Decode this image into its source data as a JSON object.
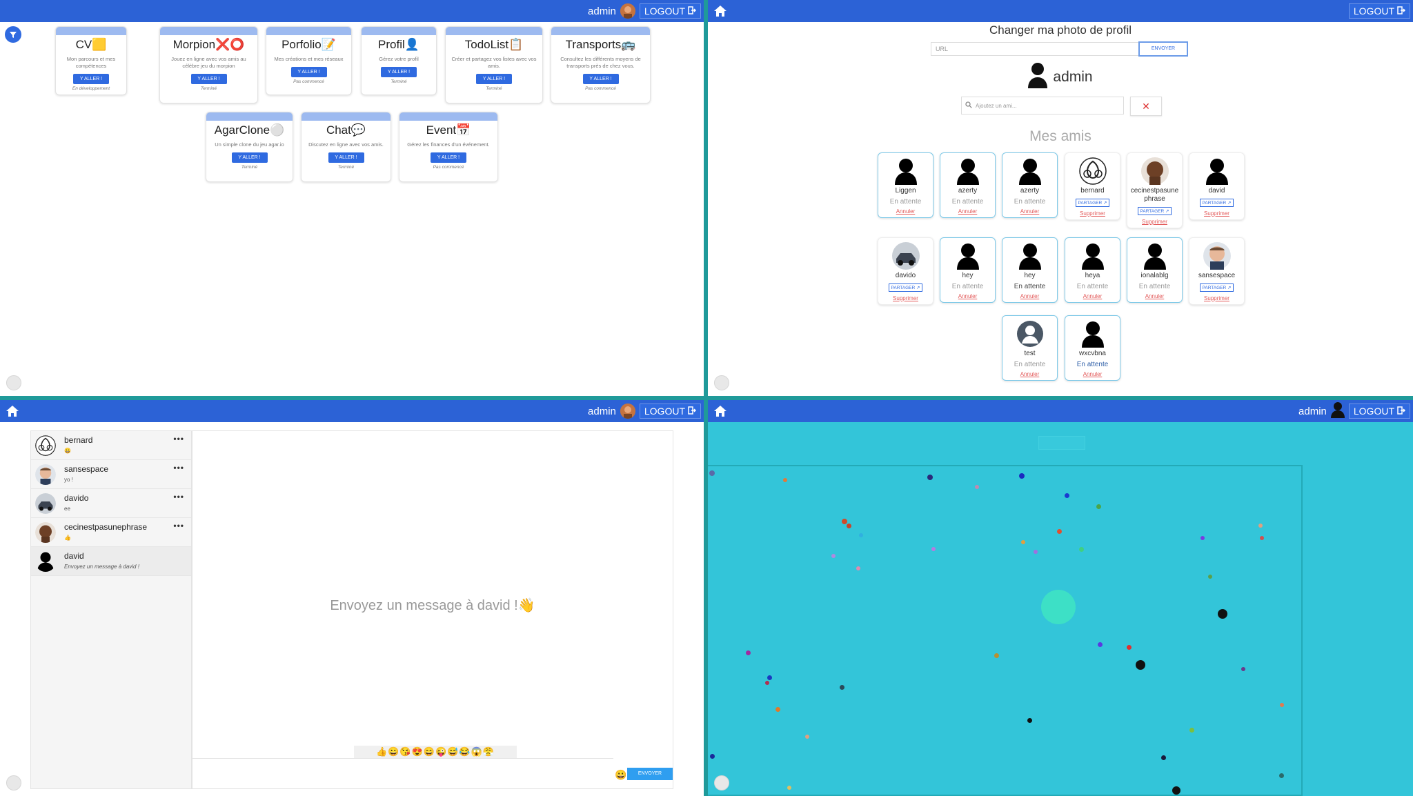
{
  "nav": {
    "user": "admin",
    "logout_label": "LOGOUT"
  },
  "projects": [
    {
      "title": "CV",
      "emoji": "🟨",
      "desc": "Mon parcours et mes compétences",
      "button": "Y ALLER !",
      "status": "En développement"
    },
    {
      "title": "Morpion",
      "emoji": "❌⭕",
      "desc": "Jouez en ligne avec vos amis au célèbre jeu du morpion",
      "button": "Y ALLER !",
      "status": "Terminé"
    },
    {
      "title": "Porfolio",
      "emoji": "📝",
      "desc": "Mes créations et mes réseaux",
      "button": "Y ALLER !",
      "status": "Pas commencé"
    },
    {
      "title": "Profil",
      "emoji": "👤",
      "desc": "Gérez votre profil",
      "button": "Y ALLER !",
      "status": "Terminé"
    },
    {
      "title": "TodoList",
      "emoji": "📋",
      "desc": "Créer et partagez vos listes avec vos amis.",
      "button": "Y ALLER !",
      "status": "Terminé"
    },
    {
      "title": "Transports",
      "emoji": "🚌",
      "desc": "Consultez les différents moyens de transports près de chez vous.",
      "button": "Y ALLER !",
      "status": "Pas commencé"
    },
    {
      "title": "AgarClone",
      "emoji": "⚪",
      "desc": "Un simple clone du jeu agar.io",
      "button": "Y ALLER !",
      "status": "Terminé"
    },
    {
      "title": "Chat",
      "emoji": "💬",
      "desc": "Discutez en ligne avec vos amis.",
      "button": "Y ALLER !",
      "status": "Terminé"
    },
    {
      "title": "Event",
      "emoji": "📅",
      "desc": "Gérez les finances d'un événement.",
      "button": "Y ALLER !",
      "status": "Pas commencé"
    }
  ],
  "profile": {
    "photo_title": "Changer ma photo de profil",
    "url_placeholder": "URL",
    "send_label": "ENVOYER",
    "username": "admin",
    "add_friend_placeholder": "Ajoutez un ami...",
    "clear_label": "✕",
    "friends_title": "Mes amis",
    "friends": [
      {
        "name": "Liggen",
        "status": "En attente",
        "action": "Annuler",
        "kind": "pending",
        "status_style": "grey",
        "avatar": "person"
      },
      {
        "name": "azerty",
        "status": "En attente",
        "action": "Annuler",
        "kind": "pending",
        "status_style": "grey",
        "avatar": "person"
      },
      {
        "name": "azerty",
        "status": "En attente",
        "action": "Annuler",
        "kind": "pending",
        "status_style": "grey",
        "avatar": "person"
      },
      {
        "name": "bernard",
        "status": "PARTAGER",
        "action": "Supprimer",
        "kind": "friend",
        "status_style": "share",
        "avatar": "rebel"
      },
      {
        "name": "cecinestpasunephrase",
        "status": "PARTAGER",
        "action": "Supprimer",
        "kind": "friend",
        "status_style": "share",
        "avatar": "face-dark"
      },
      {
        "name": "david",
        "status": "PARTAGER",
        "action": "Supprimer",
        "kind": "friend",
        "status_style": "share",
        "avatar": "person"
      },
      {
        "name": "davido",
        "status": "PARTAGER",
        "action": "Supprimer",
        "kind": "friend",
        "status_style": "share",
        "avatar": "car"
      },
      {
        "name": "hey",
        "status": "En attente",
        "action": "Annuler",
        "kind": "pending",
        "status_style": "grey",
        "avatar": "person"
      },
      {
        "name": "hey",
        "status": "En attente",
        "action": "Annuler",
        "kind": "pending",
        "status_style": "dark",
        "avatar": "person"
      },
      {
        "name": "heya",
        "status": "En attente",
        "action": "Annuler",
        "kind": "pending",
        "status_style": "grey",
        "avatar": "person"
      },
      {
        "name": "ionalablg",
        "status": "En attente",
        "action": "Annuler",
        "kind": "pending",
        "status_style": "grey",
        "avatar": "person"
      },
      {
        "name": "sansespace",
        "status": "PARTAGER",
        "action": "Supprimer",
        "kind": "friend",
        "status_style": "share",
        "avatar": "face-light"
      },
      {
        "name": "test",
        "status": "En attente",
        "action": "Annuler",
        "kind": "pending",
        "status_style": "grey",
        "avatar": "circle-person"
      },
      {
        "name": "wxcvbna",
        "status": "En attente",
        "action": "Annuler",
        "kind": "pending",
        "status_style": "blue",
        "avatar": "person"
      }
    ]
  },
  "chat": {
    "conversations": [
      {
        "name": "bernard",
        "last": "😀",
        "more": "•••"
      },
      {
        "name": "sansespace",
        "last": "yo !",
        "more": "•••"
      },
      {
        "name": "davido",
        "last": "ee",
        "more": "•••"
      },
      {
        "name": "cecinestpasunephrase",
        "last": "👍",
        "more": "•••"
      },
      {
        "name": "david",
        "last": "Envoyez un message à david !",
        "more": ""
      }
    ],
    "empty_message": "Envoyez un message à david !👋",
    "emojis": "👍😀😘😍😄😜😅😂😱😤",
    "emoji_button": "😀",
    "send_label": "ENVOYER"
  },
  "colors": {
    "navbar": "#2c62d6",
    "accent": "#2f6ae0",
    "game_background": "#33c5d9",
    "divider": "#1f9a9a"
  },
  "icons": {
    "home": "home-icon",
    "logout": "logout-icon",
    "filter": "filter-icon",
    "theme": "moon-icon",
    "search": "search-icon"
  }
}
